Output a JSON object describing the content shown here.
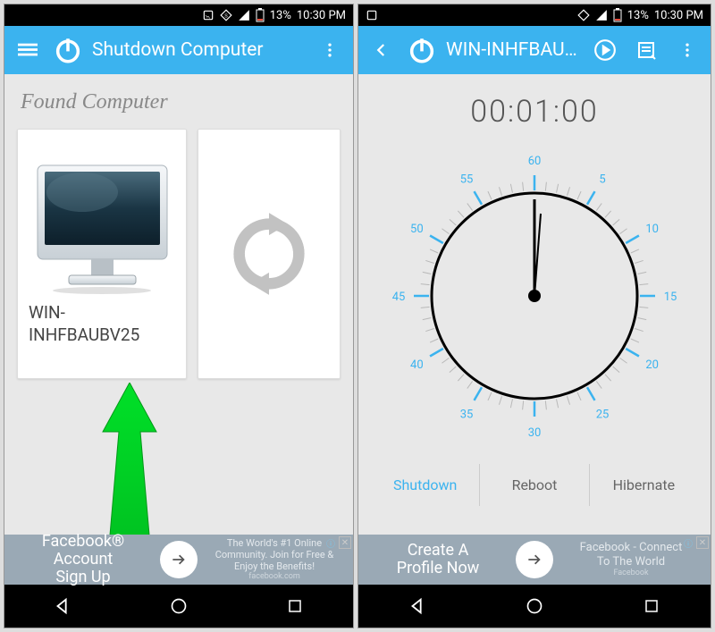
{
  "status": {
    "battery": "13%",
    "time": "10:30 PM"
  },
  "left": {
    "appTitle": "Shutdown Computer",
    "sectionTitle": "Found Computer",
    "computerName": "WIN-INHFBAUBV25",
    "ad": {
      "leftLine1": "Facebook® Account",
      "leftLine2": "Sign Up",
      "rightLine1": "The World's #1 Online",
      "rightLine2": "Community. Join for Free &",
      "rightLine3": "Enjoy the Benefits!",
      "rightLine4": "facebook.com"
    }
  },
  "right": {
    "appTitle": "WIN-INHFBAUB..",
    "timer": "00:01:00",
    "dialLabels": [
      "60",
      "5",
      "10",
      "15",
      "20",
      "25",
      "30",
      "35",
      "40",
      "45",
      "50",
      "55"
    ],
    "actions": {
      "shutdown": "Shutdown",
      "reboot": "Reboot",
      "hibernate": "Hibernate"
    },
    "ad": {
      "leftLine1": "Create A",
      "leftLine2": "Profile Now",
      "rightLine1": "Facebook - Connect",
      "rightLine2": "To The World",
      "rightLine3": "Facebook"
    }
  }
}
